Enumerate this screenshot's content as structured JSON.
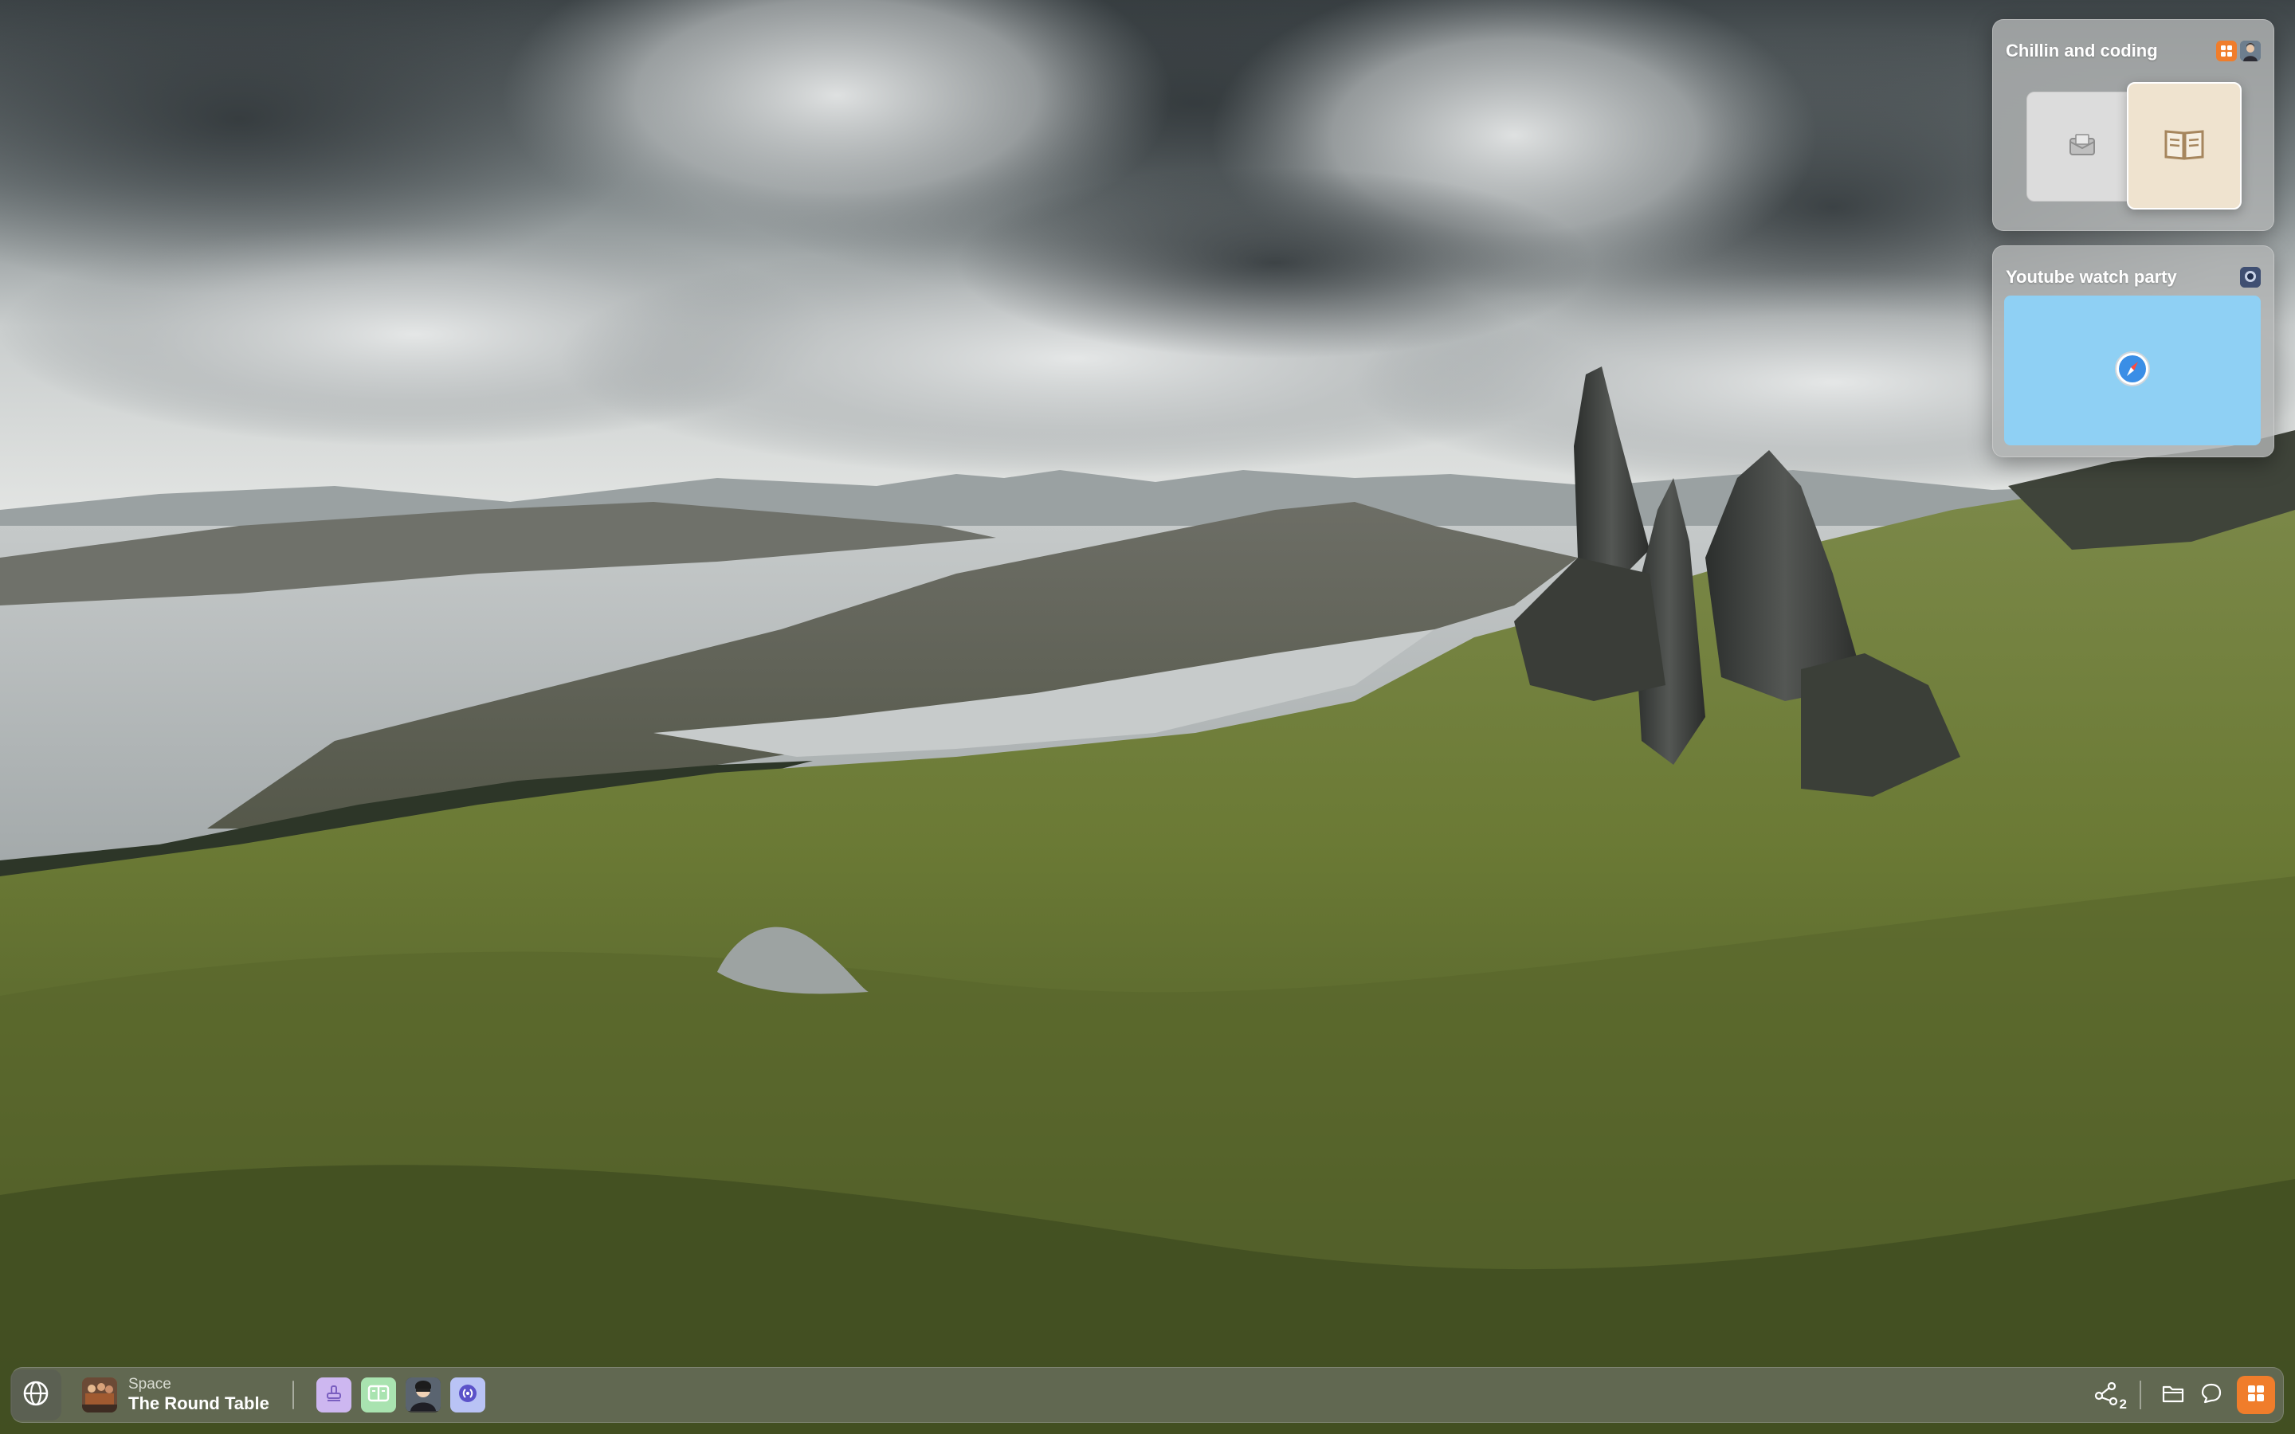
{
  "colors": {
    "accent": "#f07d2b",
    "card_bg": "#b0b2b2",
    "safari_tile": "#8fd0f4",
    "book_tile": "#efe3cf",
    "mail_tile": "#dcdcdc"
  },
  "cards": [
    {
      "title": "Chillin and coding",
      "header_icons": [
        "grid-icon",
        "avatar-icon"
      ],
      "tiles": [
        "mail-icon",
        "book-icon"
      ]
    },
    {
      "title": "Youtube watch party",
      "header_icons": [
        "avatar-icon"
      ],
      "tiles": [
        "safari-compass-icon"
      ]
    }
  ],
  "dock": {
    "space_label": "Space",
    "space_name": "The Round Table",
    "apps": [
      "stamp-icon",
      "reader-icon",
      "avatar-icon",
      "voice-icon"
    ],
    "share_count": "2",
    "tools": [
      "share-icon",
      "folder-icon",
      "chat-icon",
      "grid-icon"
    ]
  }
}
